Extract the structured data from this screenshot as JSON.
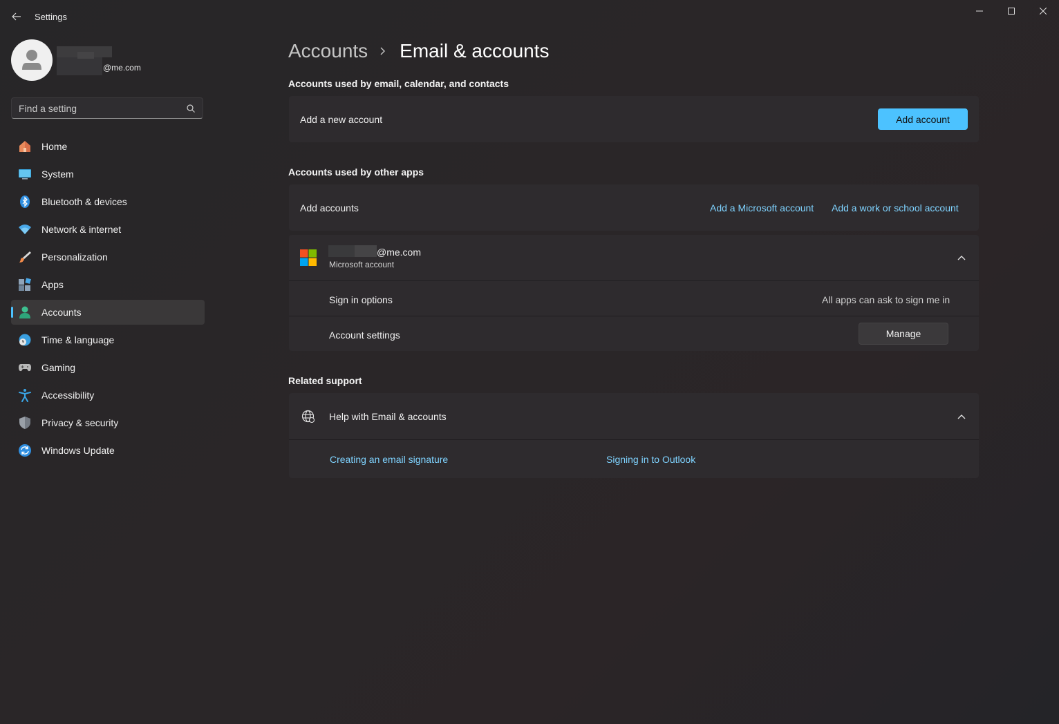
{
  "window": {
    "title": "Settings",
    "controls": {
      "minimize": "minimize-icon",
      "maximize": "maximize-icon",
      "close": "close-icon"
    }
  },
  "profile": {
    "email_suffix": "@me.com"
  },
  "search": {
    "placeholder": "Find a setting"
  },
  "sidebar": {
    "items": [
      {
        "label": "Home",
        "icon": "home-icon"
      },
      {
        "label": "System",
        "icon": "system-icon"
      },
      {
        "label": "Bluetooth & devices",
        "icon": "bluetooth-icon"
      },
      {
        "label": "Network & internet",
        "icon": "wifi-icon"
      },
      {
        "label": "Personalization",
        "icon": "brush-icon"
      },
      {
        "label": "Apps",
        "icon": "apps-icon"
      },
      {
        "label": "Accounts",
        "icon": "accounts-icon",
        "active": true
      },
      {
        "label": "Time & language",
        "icon": "globe-clock-icon"
      },
      {
        "label": "Gaming",
        "icon": "gamepad-icon"
      },
      {
        "label": "Accessibility",
        "icon": "accessibility-icon"
      },
      {
        "label": "Privacy & security",
        "icon": "shield-icon"
      },
      {
        "label": "Windows Update",
        "icon": "update-icon"
      }
    ]
  },
  "breadcrumb": {
    "parent": "Accounts",
    "current": "Email & accounts"
  },
  "email_section": {
    "title": "Accounts used by email, calendar, and contacts",
    "row_label": "Add a new account",
    "button": "Add account"
  },
  "other_apps": {
    "title": "Accounts used by other apps",
    "add_label": "Add accounts",
    "link_ms": "Add a Microsoft account",
    "link_work": "Add a work or school account",
    "account": {
      "email_suffix": "@me.com",
      "type": "Microsoft account",
      "signin_label": "Sign in options",
      "signin_value": "All apps can ask to sign me in",
      "settings_label": "Account settings",
      "manage_button": "Manage"
    }
  },
  "related": {
    "title": "Related support",
    "help_label": "Help with Email & accounts",
    "links": [
      "Creating an email signature",
      "Signing in to Outlook"
    ]
  },
  "colors": {
    "accent": "#4cc2ff",
    "link": "#7fd3ff"
  }
}
